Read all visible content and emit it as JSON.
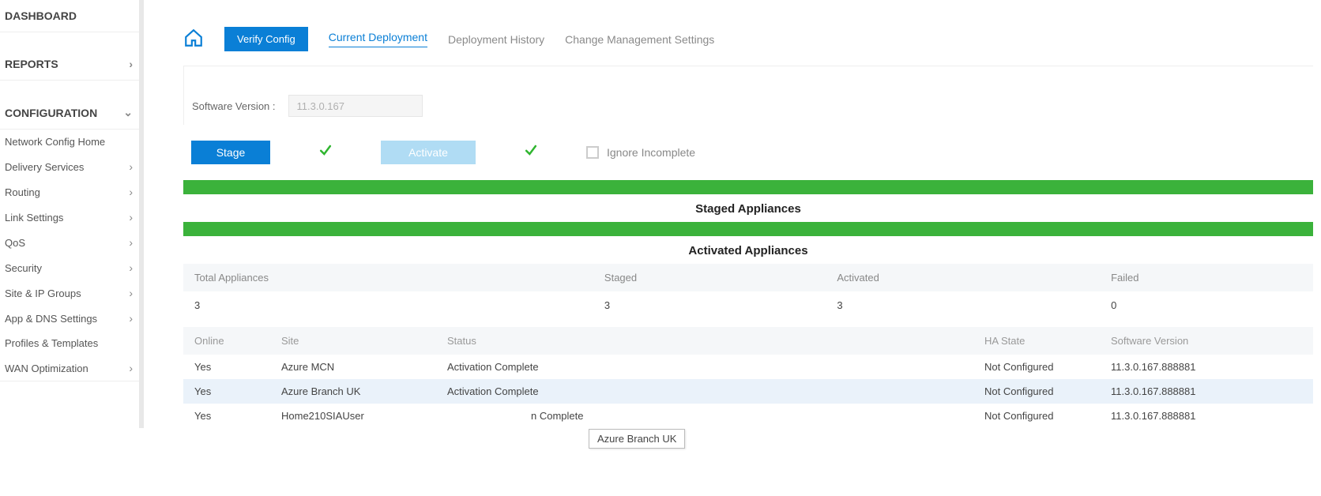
{
  "sidebar": {
    "dashboard": "DASHBOARD",
    "reports": "REPORTS",
    "configuration": "CONFIGURATION",
    "items": [
      "Network Config Home",
      "Delivery Services",
      "Routing",
      "Link Settings",
      "QoS",
      "Security",
      "Site & IP Groups",
      "App & DNS Settings",
      "Profiles & Templates",
      "WAN Optimization"
    ]
  },
  "tabs": {
    "verify": "Verify Config",
    "current": "Current Deployment",
    "history": "Deployment History",
    "settings": "Change Management Settings"
  },
  "version": {
    "label": "Software Version :",
    "value": "11.3.0.167"
  },
  "actions": {
    "stage": "Stage",
    "activate": "Activate",
    "ignore": "Ignore Incomplete"
  },
  "sections": {
    "staged": "Staged Appliances",
    "activated": "Activated Appliances"
  },
  "stats": {
    "headers": [
      "Total Appliances",
      "Staged",
      "Activated",
      "Failed"
    ],
    "values": [
      "3",
      "3",
      "3",
      "0"
    ]
  },
  "appliances": {
    "headers": [
      "Online",
      "Site",
      "Status",
      "HA State",
      "Software Version"
    ],
    "rows": [
      {
        "online": "Yes",
        "site": "Azure MCN",
        "status": "Activation Complete",
        "ha": "Not Configured",
        "sv": "11.3.0.167.888881"
      },
      {
        "online": "Yes",
        "site": "Azure Branch UK",
        "status": "Activation Complete",
        "ha": "Not Configured",
        "sv": "11.3.0.167.888881"
      },
      {
        "online": "Yes",
        "site": "Home210SIAUser",
        "status": "n Complete",
        "ha": "Not Configured",
        "sv": "11.3.0.167.888881"
      }
    ]
  },
  "tooltip": "Azure Branch UK"
}
